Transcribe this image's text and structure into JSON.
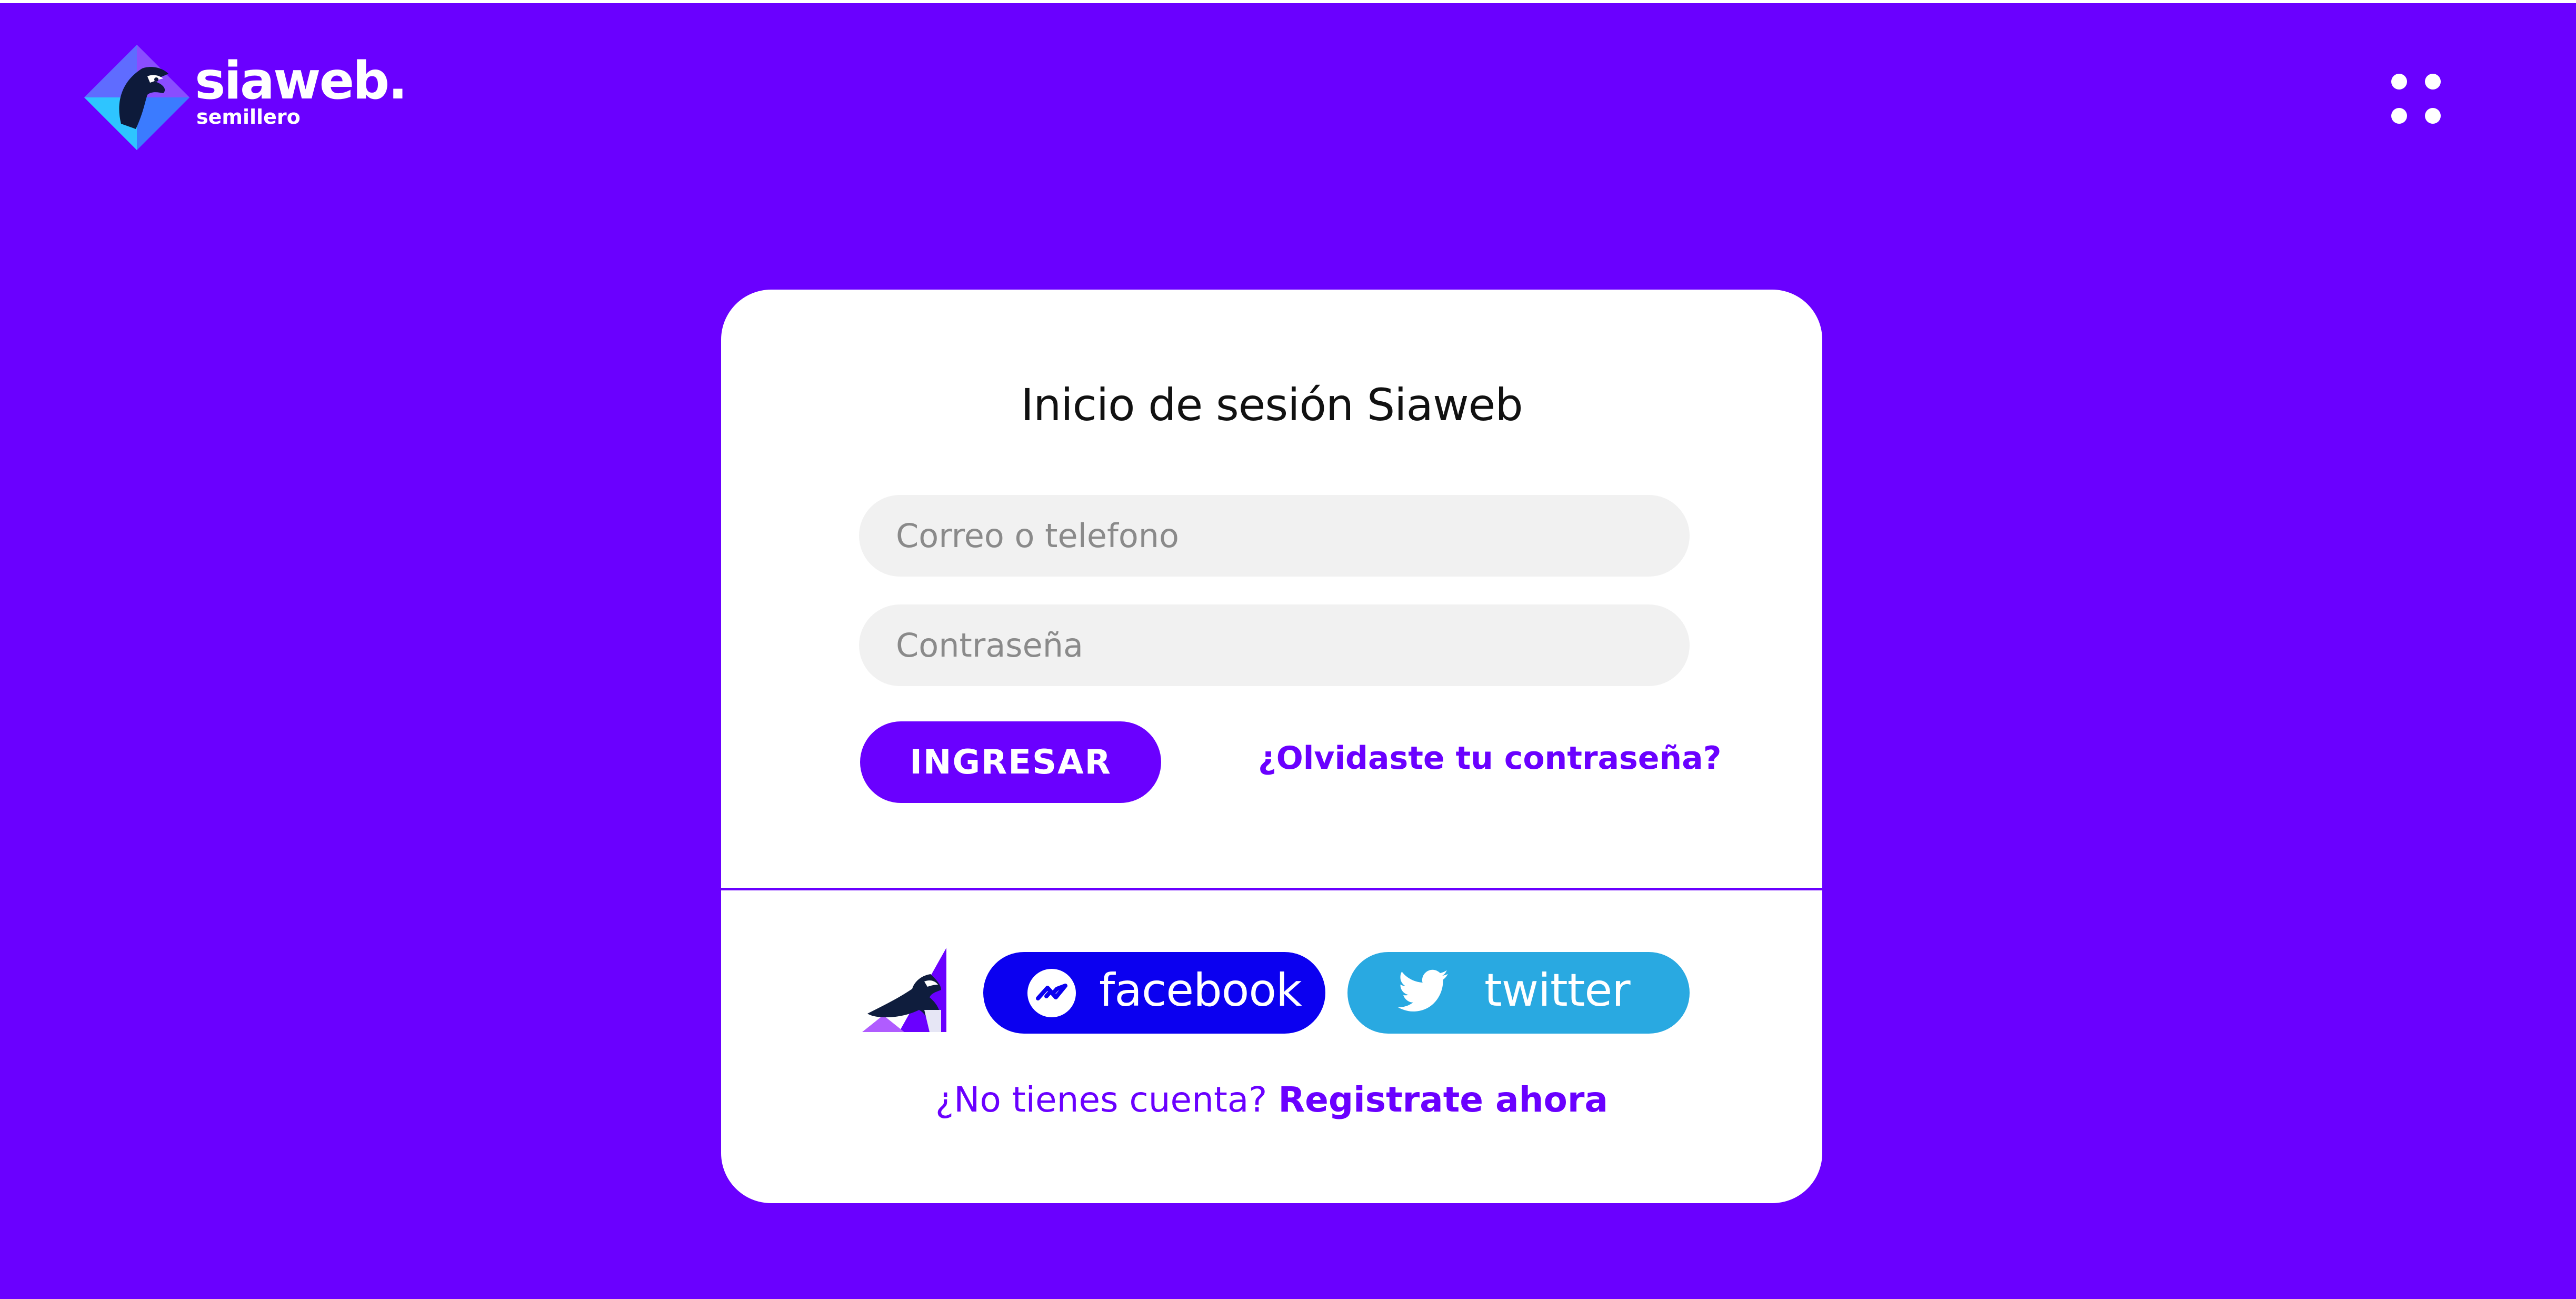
{
  "brand": {
    "name": "siaweb.",
    "tagline": "semillero"
  },
  "menu": {
    "icon": "four-dots-menu-icon"
  },
  "login": {
    "title": "Inicio de sesión Siaweb",
    "email_placeholder": "Correo o telefono",
    "password_placeholder": "Contraseña",
    "submit_label": "INGRESAR",
    "forgot_label": "¿Olvidaste tu contraseña?"
  },
  "social": {
    "facebook_label": "facebook",
    "twitter_label": "twitter"
  },
  "signup": {
    "prompt": "¿No tienes cuenta?",
    "link_label": "Registrate ahora"
  },
  "colors": {
    "background": "#6a00ff",
    "card": "#ffffff",
    "accent": "#6a00ff",
    "facebook": "#0b00f0",
    "twitter": "#29a9e1",
    "field": "#f1f1f1"
  }
}
